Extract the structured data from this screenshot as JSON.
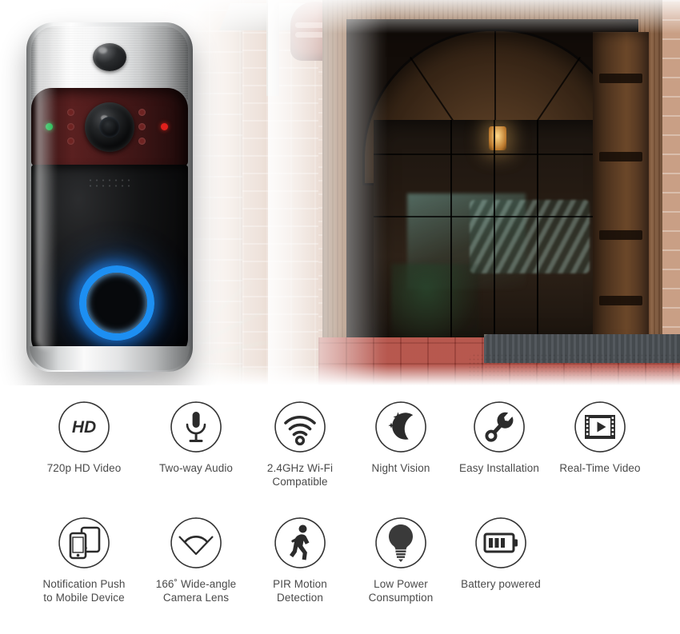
{
  "product": {
    "name": "smart-video-doorbell",
    "indicator_led_green": "#19b74a",
    "indicator_led_red": "#e0201c",
    "button_ring_color": "#1d8ff2",
    "body_color_top": "#e6e7e8",
    "body_color_bottom": "#0a0b0c",
    "ir_band_color": "#4a1a1a"
  },
  "hero": {
    "scene": "front-door-entrance-photo"
  },
  "features": {
    "label_color": "#4a4a4a",
    "row1": [
      {
        "icon": "hd-icon",
        "label": "720p HD Video"
      },
      {
        "icon": "microphone-icon",
        "label": "Two-way Audio"
      },
      {
        "icon": "wifi-icon",
        "label": "2.4GHz Wi-Fi\nCompatible"
      },
      {
        "icon": "moon-stars-icon",
        "label": "Night Vision"
      },
      {
        "icon": "wrench-icon",
        "label": "Easy Installation"
      },
      {
        "icon": "film-play-icon",
        "label": "Real-Time Video"
      }
    ],
    "row2": [
      {
        "icon": "mobile-devices-icon",
        "label": "Notification Push\nto Mobile Device"
      },
      {
        "icon": "wide-angle-icon",
        "label": "166˚ Wide-angle\nCamera Lens"
      },
      {
        "icon": "walking-person-icon",
        "label": "PIR Motion\nDetection"
      },
      {
        "icon": "lightbulb-icon",
        "label": "Low Power\nConsumption"
      },
      {
        "icon": "battery-icon",
        "label": "Battery powered"
      }
    ]
  }
}
